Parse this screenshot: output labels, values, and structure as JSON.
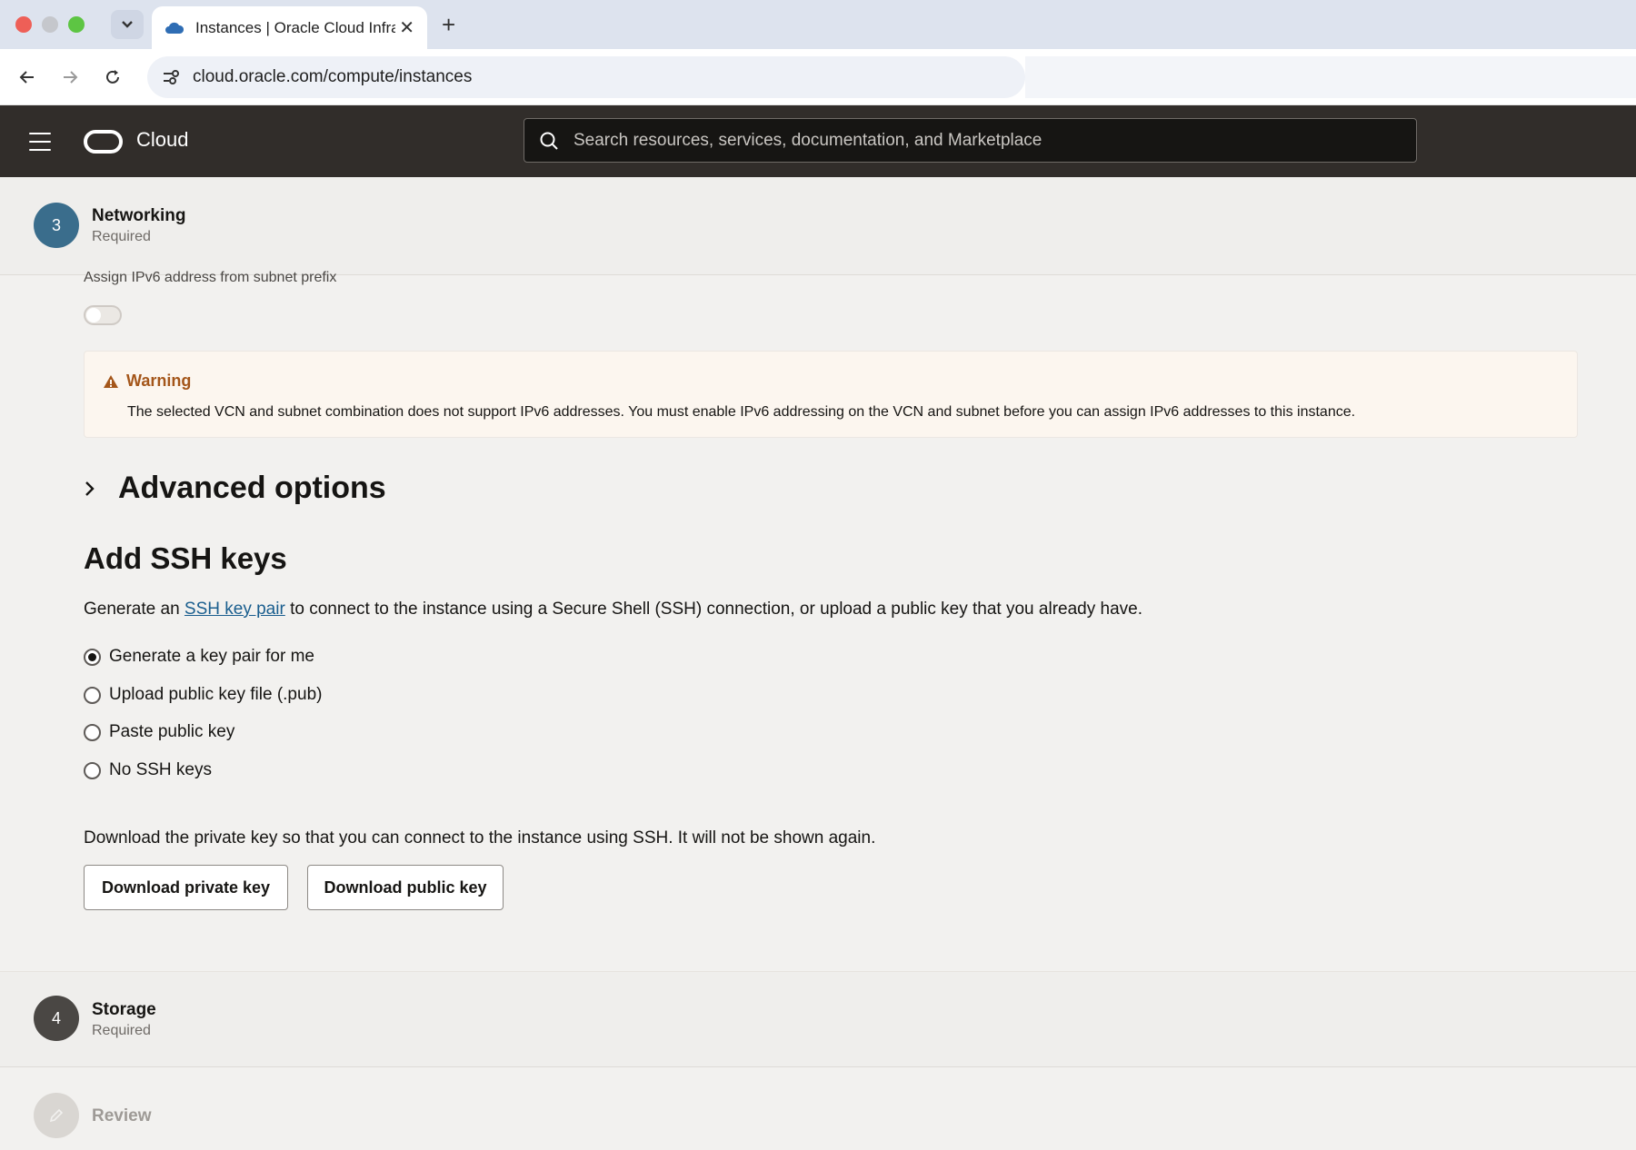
{
  "browser": {
    "tab_title": "Instances | Oracle Cloud Infra",
    "url": "cloud.oracle.com/compute/instances"
  },
  "header": {
    "brand": "Cloud",
    "search_placeholder": "Search resources, services, documentation, and Marketplace"
  },
  "steps": {
    "networking": {
      "number": "3",
      "title": "Networking",
      "status": "Required"
    },
    "storage": {
      "number": "4",
      "title": "Storage",
      "status": "Required"
    },
    "review": {
      "title": "Review"
    }
  },
  "networking": {
    "ipv6_label": "Assign IPv6 address from subnet prefix",
    "ipv6_enabled": false,
    "warning": {
      "title": "Warning",
      "text": "The selected VCN and subnet combination does not support IPv6 addresses. You must enable IPv6 addressing on the VCN and subnet before you can assign IPv6 addresses to this instance."
    },
    "advanced_options_label": "Advanced options"
  },
  "ssh": {
    "title": "Add SSH keys",
    "desc_before": "Generate an ",
    "desc_link": "SSH key pair",
    "desc_after": " to connect to the instance using a Secure Shell (SSH) connection, or upload a public key that you already have.",
    "options": [
      {
        "label": "Generate a key pair for me",
        "checked": true
      },
      {
        "label": "Upload public key file (.pub)",
        "checked": false
      },
      {
        "label": "Paste public key",
        "checked": false
      },
      {
        "label": "No SSH keys",
        "checked": false
      }
    ],
    "download_desc": "Download the private key so that you can connect to the instance using SSH. It will not be shown again.",
    "download_private_label": "Download private key",
    "download_public_label": "Download public key"
  },
  "colors": {
    "header_bg": "#312d2a",
    "networking_step": "#3a6d8c",
    "storage_step": "#4a4744",
    "warning_accent": "#a4561a",
    "link": "#1a5e8e"
  }
}
